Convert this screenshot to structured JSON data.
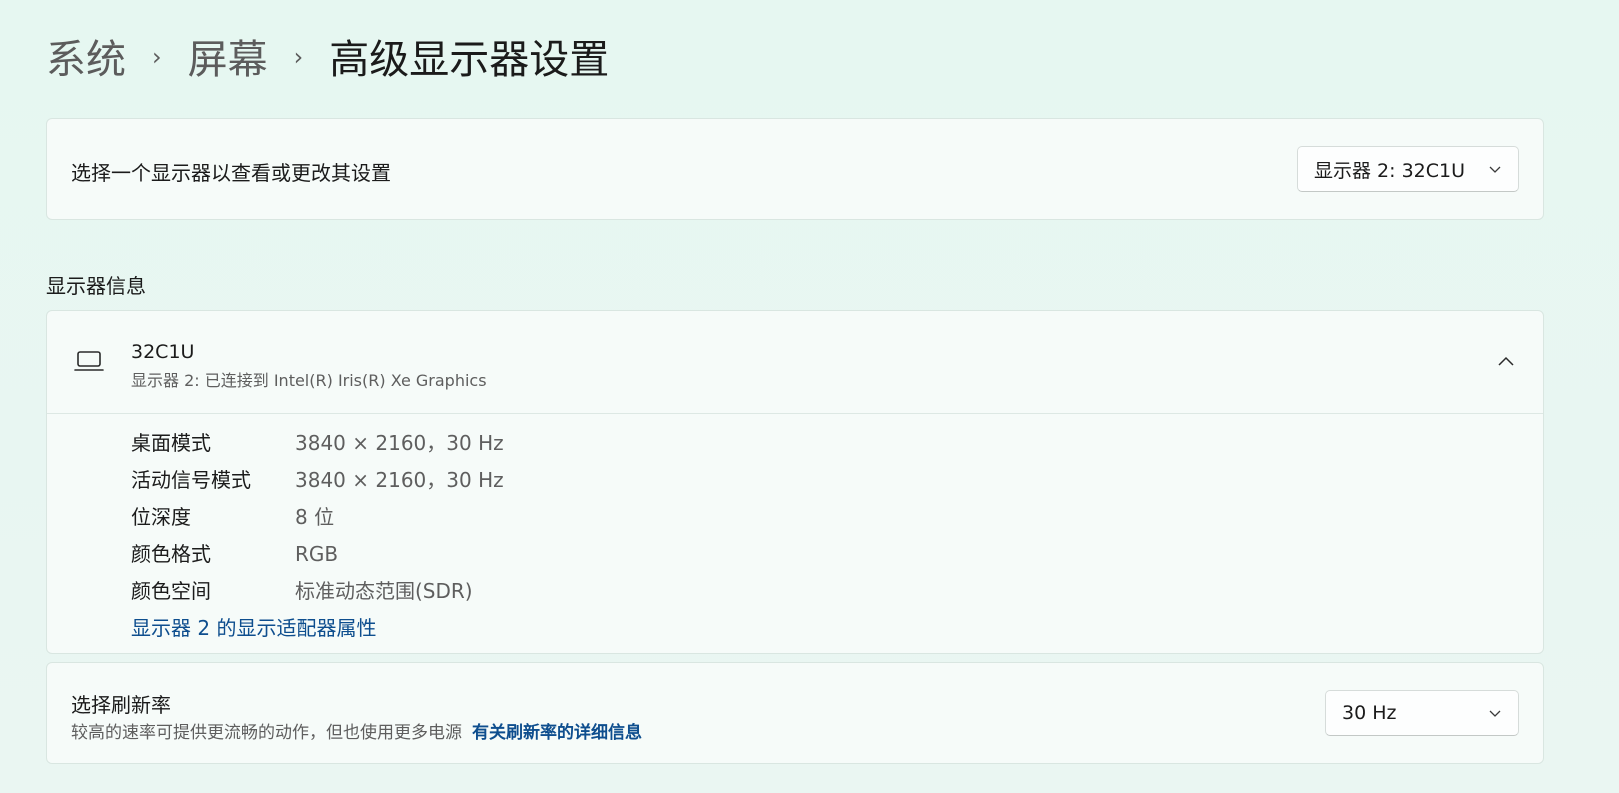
{
  "breadcrumb": {
    "items": [
      "系统",
      "屏幕"
    ],
    "current": "高级显示器设置",
    "separator": "›"
  },
  "select_display": {
    "label": "选择一个显示器以查看或更改其设置",
    "dropdown_value": "显示器 2: 32C1U"
  },
  "display_info": {
    "section_title": "显示器信息",
    "name": "32C1U",
    "subtitle": "显示器 2: 已连接到 Intel(R) Iris(R) Xe Graphics",
    "properties": [
      {
        "key": "桌面模式",
        "value": "3840 × 2160，30 Hz"
      },
      {
        "key": "活动信号模式",
        "value": "3840 × 2160，30 Hz"
      },
      {
        "key": "位深度",
        "value": "8 位"
      },
      {
        "key": "颜色格式",
        "value": "RGB"
      },
      {
        "key": "颜色空间",
        "value": "标准动态范围(SDR)"
      }
    ],
    "adapter_link": "显示器 2 的显示适配器属性"
  },
  "refresh_rate": {
    "title": "选择刷新率",
    "description": "较高的速率可提供更流畅的动作，但也使用更多电源",
    "link": "有关刷新率的详细信息",
    "dropdown_value": "30 Hz"
  },
  "icons": {
    "laptop": "laptop-icon",
    "dropdown": "chevron-down-icon",
    "collapse": "chevron-up-icon"
  },
  "colors": {
    "background": "#e6f7f1",
    "card": "#f6fbf9",
    "link": "#0e4e8e"
  }
}
